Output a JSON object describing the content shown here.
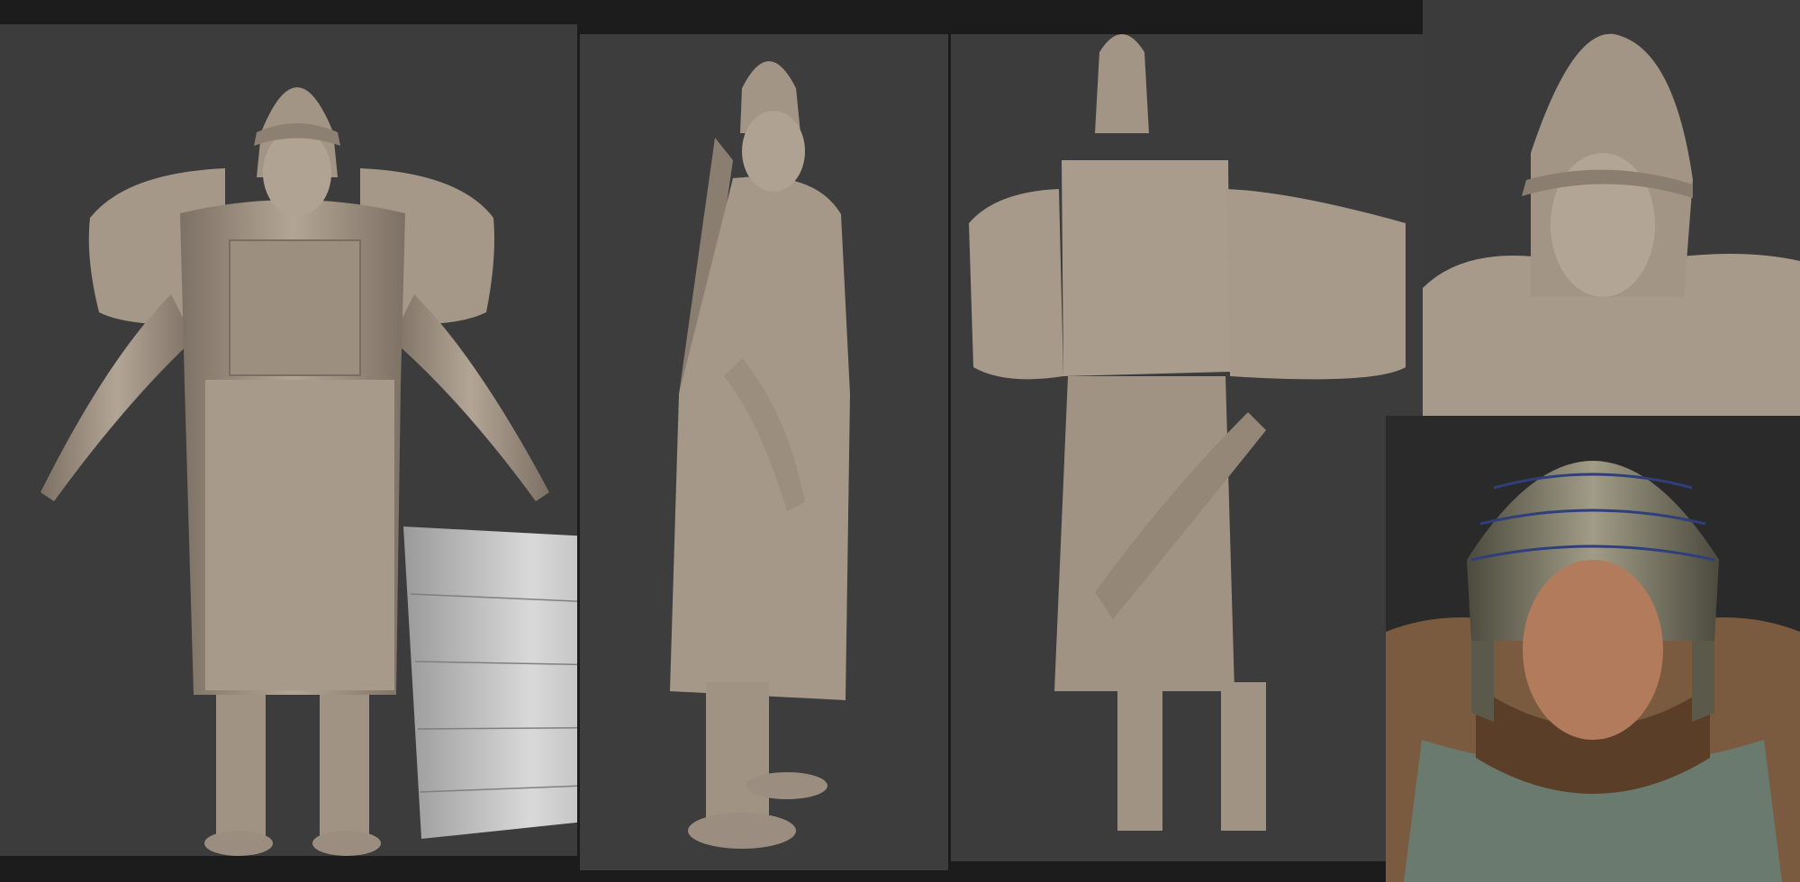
{
  "title": "",
  "panels": [
    {
      "id": "front",
      "description_icon": "figure-front"
    },
    {
      "id": "side",
      "description_icon": "figure-side"
    },
    {
      "id": "back",
      "description_icon": "figure-back"
    },
    {
      "id": "head-sculpt",
      "description_icon": "head-closeup"
    },
    {
      "id": "render",
      "description_icon": "render-closeup"
    }
  ],
  "colors": {
    "background": "#1c1c1c",
    "viewport": "#3c3c3c",
    "clay": "#a89a8b",
    "clay_shadow": "#6f655a",
    "clay_light": "#c9bcaf",
    "armor_plate": "#bdbdbd",
    "helmet_metal": "#8c8a78",
    "skin": "#b07a5c"
  }
}
